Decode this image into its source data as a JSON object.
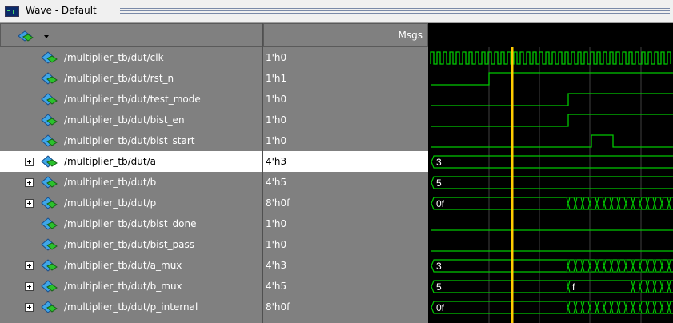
{
  "window": {
    "title": "Wave - Default"
  },
  "header": {
    "msgs_label": "Msgs"
  },
  "signals": [
    {
      "name": "/multiplier_tb/dut/clk",
      "value": "1'h0",
      "expandable": false,
      "selected": false
    },
    {
      "name": "/multiplier_tb/dut/rst_n",
      "value": "1'h1",
      "expandable": false,
      "selected": false
    },
    {
      "name": "/multiplier_tb/dut/test_mode",
      "value": "1'h0",
      "expandable": false,
      "selected": false
    },
    {
      "name": "/multiplier_tb/dut/bist_en",
      "value": "1'h0",
      "expandable": false,
      "selected": false
    },
    {
      "name": "/multiplier_tb/dut/bist_start",
      "value": "1'h0",
      "expandable": false,
      "selected": false
    },
    {
      "name": "/multiplier_tb/dut/a",
      "value": "4'h3",
      "expandable": true,
      "selected": true
    },
    {
      "name": "/multiplier_tb/dut/b",
      "value": "4'h5",
      "expandable": true,
      "selected": false
    },
    {
      "name": "/multiplier_tb/dut/p",
      "value": "8'h0f",
      "expandable": true,
      "selected": false
    },
    {
      "name": "/multiplier_tb/dut/bist_done",
      "value": "1'h0",
      "expandable": false,
      "selected": false
    },
    {
      "name": "/multiplier_tb/dut/bist_pass",
      "value": "1'h0",
      "expandable": false,
      "selected": false
    },
    {
      "name": "/multiplier_tb/dut/a_mux",
      "value": "4'h3",
      "expandable": true,
      "selected": false
    },
    {
      "name": "/multiplier_tb/dut/b_mux",
      "value": "4'h5",
      "expandable": true,
      "selected": false
    },
    {
      "name": "/multiplier_tb/dut/p_internal",
      "value": "8'h0f",
      "expandable": true,
      "selected": false
    }
  ],
  "wave_labels": {
    "a": "3",
    "b": "5",
    "p": "0f",
    "a_mux": "3",
    "b_mux": "5",
    "b_mux_later": "f",
    "p_internal": "0f"
  },
  "colors": {
    "wave": "#00c800",
    "cursor": "#ffcc00",
    "background": "#000000",
    "grid": "#404040",
    "panel": "#808080",
    "selected_row": "#ffffff"
  },
  "icons": {
    "signal": "diamond-signal-icon",
    "window": "wave-window-icon",
    "signal_menu": "signal-menu-icon"
  }
}
